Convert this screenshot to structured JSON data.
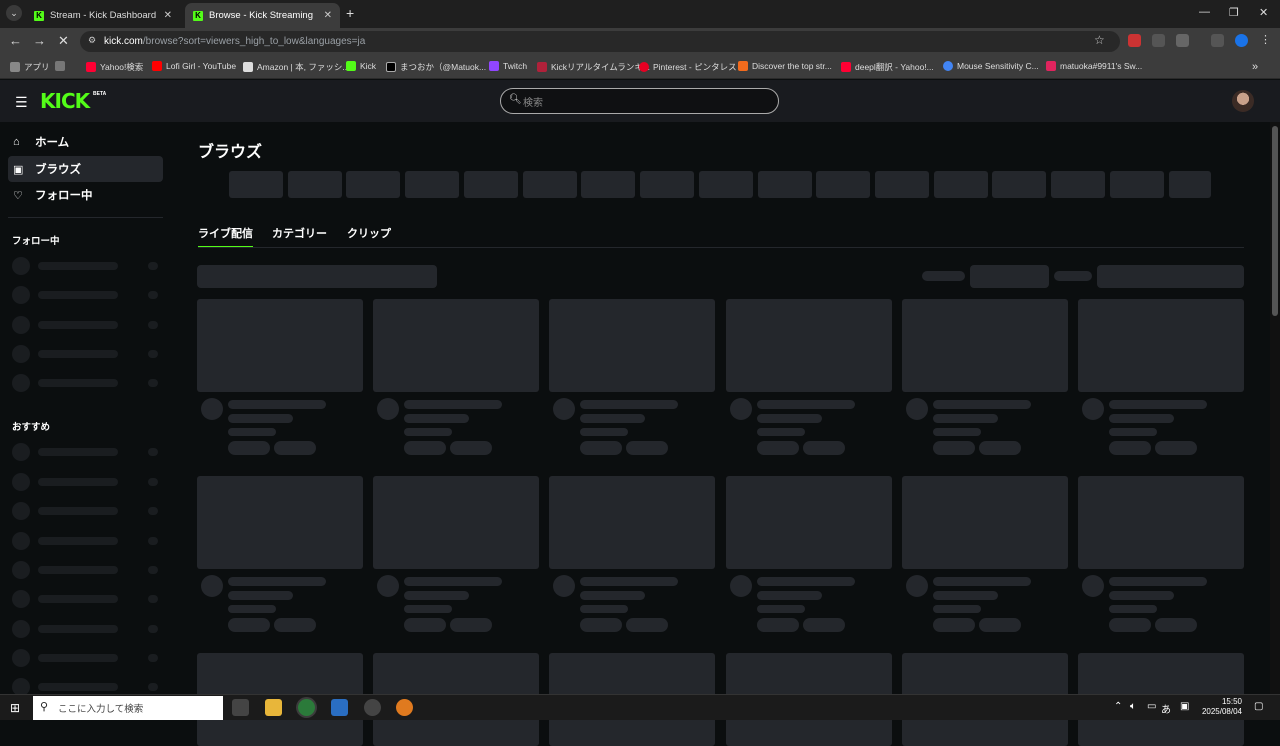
{
  "browser": {
    "tabs": [
      {
        "title": "Stream - Kick Dashboard",
        "active": false
      },
      {
        "title": "Browse - Kick Streaming",
        "active": true
      }
    ],
    "url_host": "kick.com",
    "url_rest": "/browse?sort=viewers_high_to_low&languages=ja",
    "bookmarks": [
      {
        "label": "アプリ",
        "color": "#888888"
      },
      {
        "label": "Yahoo!検索",
        "color": "#ff0033"
      },
      {
        "label": "Lofi Girl - YouTube",
        "color": "#ff0000"
      },
      {
        "label": "Amazon | 本, ファッシ...",
        "color": "#dddddd"
      },
      {
        "label": "Kick",
        "color": "#53fc18"
      },
      {
        "label": "まつおか（@Matuok...",
        "color": "#000000"
      },
      {
        "label": "Twitch",
        "color": "#9146ff"
      },
      {
        "label": "Kickリアルタイムランキ...",
        "color": "#b0213a"
      },
      {
        "label": "Pinterest - ピンタレスト",
        "color": "#e60023"
      },
      {
        "label": "Discover the top str...",
        "color": "#f26b1d"
      },
      {
        "label": "deepl翻訳 - Yahoo!...",
        "color": "#ff0033"
      },
      {
        "label": "Mouse Sensitivity C...",
        "color": "#4285f4"
      },
      {
        "label": "matuoka#9911's Sw...",
        "color": "#e0245e"
      }
    ]
  },
  "header": {
    "logo": "KICK",
    "beta": "BETA",
    "search_placeholder": "検索"
  },
  "sidebar": {
    "nav": [
      {
        "label": "ホーム",
        "icon": "home-icon",
        "selected": false
      },
      {
        "label": "ブラウズ",
        "icon": "browse-icon",
        "selected": true
      },
      {
        "label": "フォロー中",
        "icon": "heart-icon",
        "selected": false
      }
    ],
    "following_heading": "フォロー中",
    "recommended_heading": "おすすめ"
  },
  "main": {
    "title": "ブラウズ",
    "tabs": [
      {
        "label": "ライブ配信",
        "active": true
      },
      {
        "label": "カテゴリー",
        "active": false
      },
      {
        "label": "クリップ",
        "active": false
      }
    ]
  },
  "taskbar": {
    "search_placeholder": "ここに入力して検索",
    "ime": "あ",
    "time": "15:50",
    "date": "2025/08/04"
  },
  "colors": {
    "accent": "#53fc18",
    "background": "#0b0e0f",
    "skeleton": "#24272c"
  }
}
